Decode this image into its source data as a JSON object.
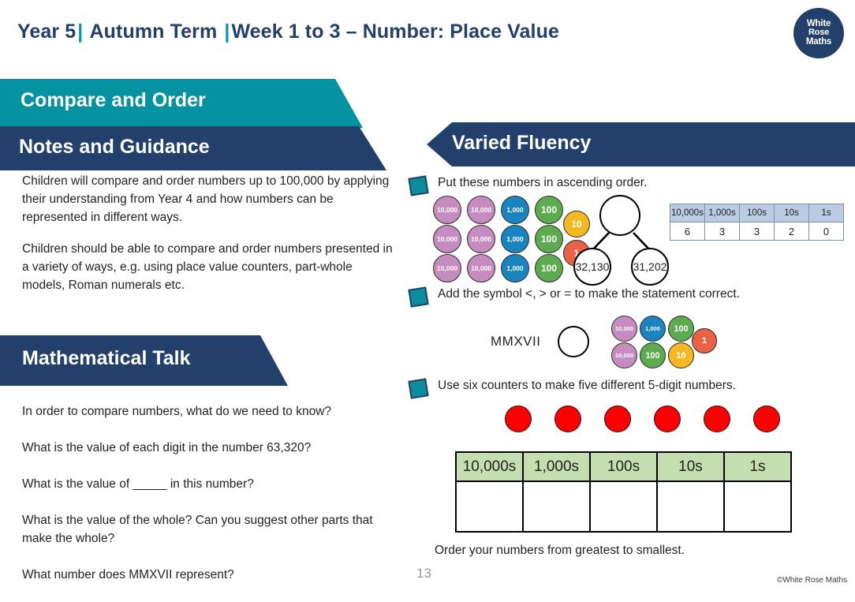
{
  "header": {
    "year": "Year 5",
    "term": "Autumn Term",
    "week": "Week 1 to 3 – Number: Place Value",
    "separator": "|",
    "logo": {
      "line1": "White",
      "line2": "Rose",
      "line3": "Maths"
    }
  },
  "left": {
    "topic_banner": "Compare and Order",
    "notes_banner": "Notes and Guidance",
    "talk_banner": "Mathematical Talk",
    "notes_paragraphs": [
      "Children will compare and order numbers up to 100,000 by applying their understanding from Year 4 and how numbers can be represented in different ways.",
      "Children should be able to compare and order numbers presented in a variety of ways, e.g. using place value counters, part-whole models, Roman numerals etc."
    ],
    "talk_questions": [
      "In order to compare numbers, what do we need to know?",
      "What is the value of each digit in the number 63,320?",
      "What is the value of _____ in this number?",
      "What is the value of the whole? Can you suggest other parts that make the whole?",
      "What number does MMXVII represent?"
    ]
  },
  "right": {
    "banner": "Varied Fluency",
    "q1": {
      "text": "Put these numbers in ascending order.",
      "counter_grid": [
        [
          "10,000",
          "10,000",
          "1,000",
          "100"
        ],
        [
          "10,000",
          "10,000",
          "1,000",
          "100"
        ],
        [
          "10,000",
          "10,000",
          "1,000",
          "100"
        ]
      ],
      "extra_counters": [
        "10",
        "1"
      ],
      "part_whole": {
        "whole": "",
        "left_part": "32,130",
        "right_part": "31,202"
      },
      "place_value_table": {
        "headers": [
          "10,000s",
          "1,000s",
          "100s",
          "10s",
          "1s"
        ],
        "values": [
          "6",
          "3",
          "3",
          "2",
          "0"
        ]
      }
    },
    "q2": {
      "text": "Add the symbol <, > or = to make the statement correct.",
      "roman_numeral": "MMXVII",
      "counter_rows": [
        [
          "10,000",
          "1,000",
          "100"
        ],
        [
          "10,000",
          "100",
          "10"
        ]
      ],
      "side_counter": "1"
    },
    "q3": {
      "text": "Use six counters to make five different 5-digit numbers.",
      "red_counter_count": 6,
      "place_value_table": {
        "headers": [
          "10,000s",
          "1,000s",
          "100s",
          "10s",
          "1s"
        ],
        "values": [
          "",
          "",
          "",
          "",
          ""
        ]
      },
      "closing_text": "Order your numbers from greatest to smallest."
    }
  },
  "footer": {
    "page_number": "13",
    "copyright": "©White Rose Maths"
  },
  "colors": {
    "navy": "#22406b",
    "teal": "#0593a2",
    "counter_10000": "#c68cc0",
    "counter_1000": "#1a84c0",
    "counter_100": "#5cab4e",
    "counter_10": "#f5b820",
    "counter_1": "#ea6145",
    "red_counter": "#fe0000",
    "table_header_blue": "#b9cce4",
    "table_header_green": "#c3dfb0"
  }
}
